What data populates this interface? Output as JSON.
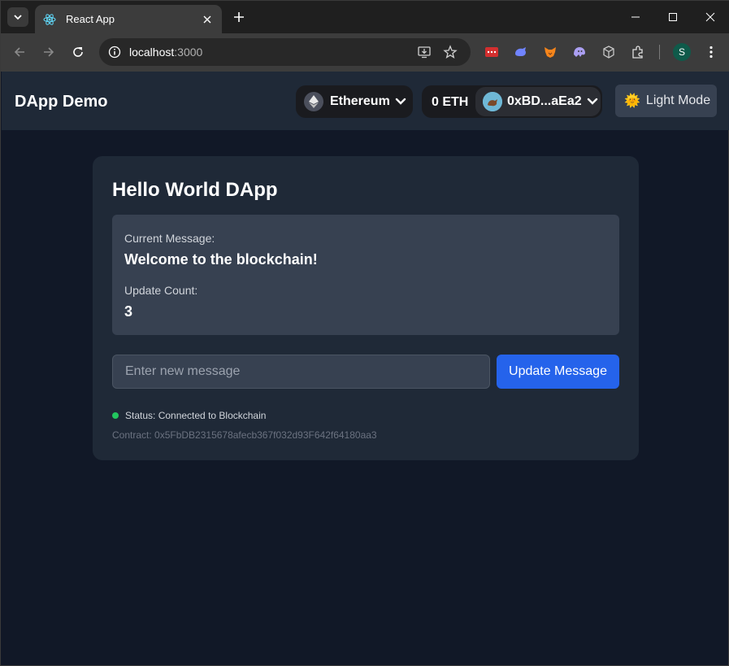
{
  "browser": {
    "tab_title": "React App",
    "url_host": "localhost",
    "url_port": ":3000",
    "profile_initial": "S"
  },
  "header": {
    "brand": "DApp Demo",
    "network": "Ethereum",
    "balance": "0 ETH",
    "address": "0xBD...aEa2",
    "mode_emoji": "🌞",
    "mode_label": "Light Mode"
  },
  "card": {
    "title": "Hello World DApp",
    "current_message_label": "Current Message:",
    "current_message": "Welcome to the blockchain!",
    "update_count_label": "Update Count:",
    "update_count": "3",
    "input_placeholder": "Enter new message",
    "update_button": "Update Message",
    "status": "Status: Connected to Blockchain",
    "contract": "Contract: 0x5FbDB2315678afecb367f032d93F642f64180aa3"
  },
  "colors": {
    "page_bg": "#111827",
    "card_bg": "#1f2937",
    "primary": "#2563eb",
    "status_ok": "#22c55e"
  }
}
